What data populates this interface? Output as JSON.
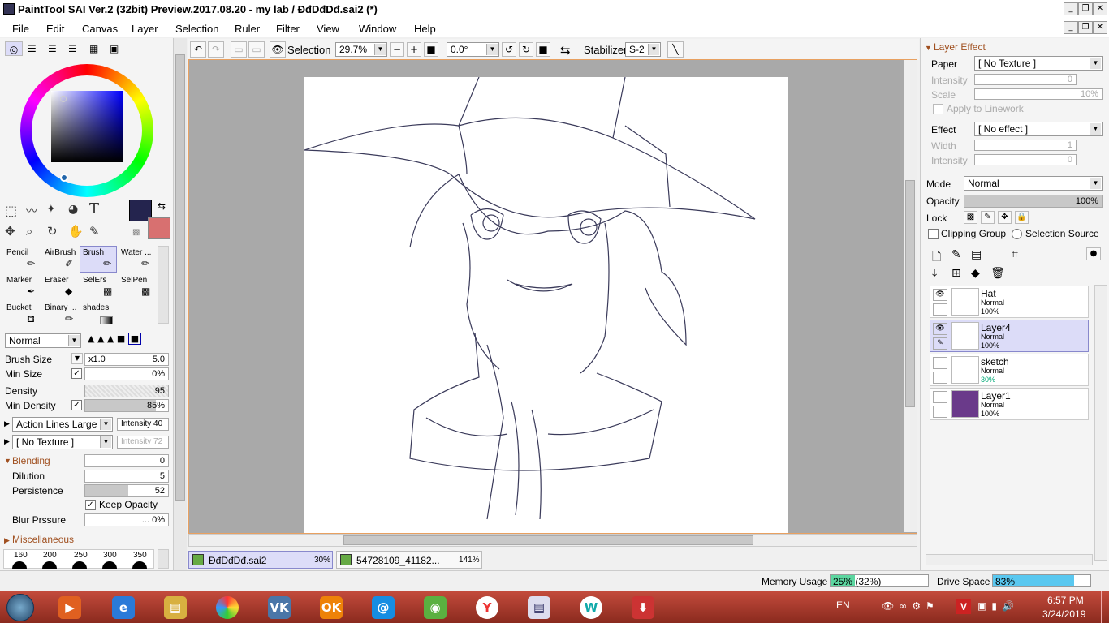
{
  "window": {
    "title": "PaintTool SAI Ver.2 (32bit) Preview.2017.08.20 - my lab / ĐđDđDđ.sai2 (*)"
  },
  "menu": [
    "File",
    "Edit",
    "Canvas",
    "Layer",
    "Selection",
    "Ruler",
    "Filter",
    "View",
    "Window",
    "Help"
  ],
  "toolbar": {
    "selection_label": "Selection",
    "zoom": "29.7%",
    "rotation": "0.0°",
    "stabilizer_label": "Stabilizer",
    "stabilizer_value": "S-2"
  },
  "tools": [
    {
      "label": "Pencil"
    },
    {
      "label": "AirBrush"
    },
    {
      "label": "Brush"
    },
    {
      "label": "Water ..."
    },
    {
      "label": "Marker"
    },
    {
      "label": "Eraser"
    },
    {
      "label": "SelErs"
    },
    {
      "label": "SelPen"
    },
    {
      "label": "Bucket"
    },
    {
      "label": "Binary ..."
    },
    {
      "label": "shades"
    }
  ],
  "brush": {
    "blend_mode": "Normal",
    "size_label": "Brush Size",
    "size_mult": "x1.0",
    "size_value": "5.0",
    "min_size_label": "Min Size",
    "min_size_value": "0%",
    "density_label": "Density",
    "density_value": "95",
    "min_density_label": "Min Density",
    "min_density_value": "85%",
    "min_density_fraction": 0.85,
    "shape": "Action Lines Large",
    "shape_intensity": "Intensity 40",
    "texture": "[ No Texture ]",
    "texture_intensity": "Intensity 72",
    "blending_label": "Blending",
    "blending_value": "0",
    "dilution_label": "Dilution",
    "dilution_value": "5",
    "persistence_label": "Persistence",
    "persistence_value": "52",
    "persistence_fraction": 0.52,
    "keep_opacity_label": "Keep Opacity",
    "blur_label": "Blur Prssure",
    "blur_value": "... 0%",
    "misc_label": "Miscellaneous",
    "presets": [
      "160",
      "200",
      "250",
      "300",
      "350"
    ]
  },
  "layer_effect": {
    "title": "Layer Effect",
    "paper_label": "Paper",
    "paper_value": "[ No Texture ]",
    "intensity_label": "Intensity",
    "intensity_value": "0",
    "scale_label": "Scale",
    "scale_value": "10%",
    "apply_label": "Apply to Linework",
    "effect_label": "Effect",
    "effect_value": "[ No effect ]",
    "width_label": "Width",
    "width_value": "1",
    "intensity2_label": "Intensity",
    "intensity2_value": "0"
  },
  "layer_props": {
    "mode_label": "Mode",
    "mode_value": "Normal",
    "opacity_label": "Opacity",
    "opacity_value": "100%",
    "lock_label": "Lock",
    "clipping_label": "Clipping Group",
    "selection_source_label": "Selection Source"
  },
  "layers": [
    {
      "name": "Hat",
      "mode": "Normal",
      "opacity": "100%"
    },
    {
      "name": "Layer4",
      "mode": "Normal",
      "opacity": "100%"
    },
    {
      "name": "sketch",
      "mode": "Normal",
      "opacity": "30%"
    },
    {
      "name": "Layer1",
      "mode": "Normal",
      "opacity": "100%"
    }
  ],
  "tabs": [
    {
      "name": "ĐđDđDđ.sai2",
      "zoom": "30%"
    },
    {
      "name": "54728109_41182...",
      "zoom": "141%"
    }
  ],
  "status": {
    "memory_label": "Memory Usage",
    "memory_value": "25% (32%)",
    "memory_fraction": 0.25,
    "drive_label": "Drive Space",
    "drive_value": "83%",
    "drive_fraction": 0.83
  },
  "taskbar": {
    "lang": "EN",
    "time": "6:57 PM",
    "date": "3/24/2019"
  },
  "colors": {
    "primary": "#24244e",
    "secondary": "#d87070",
    "accent": "#8888cc"
  }
}
